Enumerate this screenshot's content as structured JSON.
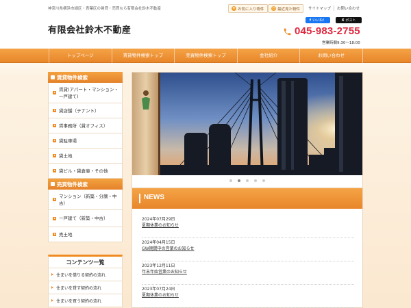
{
  "header": {
    "tagline": "神奈川県横浜市緑区・青葉区の賃貸・売買なら有限会社鈴木不動産",
    "logo": "有限会社鈴木不動産",
    "favorites_button": "お気に入り物件",
    "recent_button": "最近見た物件",
    "top_links": [
      "サイトマップ",
      "お問い合わせ"
    ],
    "like_button": "いいね！",
    "post_button": "ポスト",
    "phone": "045-983-2755",
    "hours": "営業時間9:30～18:00"
  },
  "nav": {
    "items": [
      "トップページ",
      "賃貸物件検索トップ",
      "売買物件検索トップ",
      "会社紹介",
      "お問い合わせ"
    ]
  },
  "sidebar": {
    "rental_heading": "賃貸物件検索",
    "rental_items": [
      "賃貸(アパート・マンション・一戸建て)",
      "貸店舗（テナント）",
      "賃事務所（貸オフィス）",
      "貸駐車場",
      "貸土地",
      "貸ビル・貸倉庫・その他"
    ],
    "sale_heading": "売買物件検索",
    "sale_items": [
      "マンション（新築・分譲・中古）",
      "一戸建て（新築・中古）",
      "売土地"
    ],
    "content_heading": "コンテンツ一覧",
    "content_items": [
      "住まいを借りる契約の流れ",
      "住まいを貸す契約の流れ",
      "住まいを買う契約の流れ"
    ]
  },
  "slider": {
    "slide_count": 5,
    "active_index": 1
  },
  "news": {
    "heading": "NEWS",
    "items": [
      {
        "date": "2024年07月29日",
        "title": "夏期休業のお知らせ"
      },
      {
        "date": "2024年04月15日",
        "title": "GW期間中の営業のお知らせ"
      },
      {
        "date": "2023年12月11日",
        "title": "年末年始営業のお知らせ"
      },
      {
        "date": "2023年07月24日",
        "title": "夏期休業のお知らせ"
      }
    ]
  },
  "colors": {
    "accent": "#ee8f30",
    "phone": "#e0273e",
    "facebook": "#1877f2",
    "x": "#111111"
  }
}
